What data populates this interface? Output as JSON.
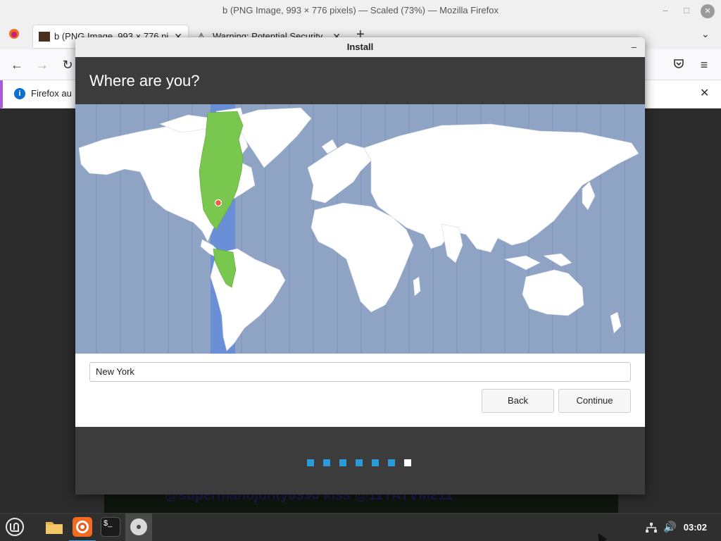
{
  "firefox": {
    "window_title": "b (PNG Image, 993 × 776 pixels) — Scaled (73%) — Mozilla Firefox",
    "tabs": [
      {
        "label": "b (PNG Image, 993 × 776 pi",
        "icon": "image-thumbnail-icon"
      },
      {
        "label": "Warning: Potential Security",
        "icon": "warning-icon"
      }
    ],
    "new_tab_label": "+",
    "notice_text": "Firefox au"
  },
  "background_image_text": "@supermanojonty6990 kiss @11YATVM211",
  "installer": {
    "window_title": "Install",
    "minimize_label": "–",
    "heading": "Where are you?",
    "timezone_input": {
      "value": "New York"
    },
    "back_label": "Back",
    "continue_label": "Continue",
    "progress": {
      "total_steps": 7,
      "current_step": 7
    },
    "colors": {
      "header": "#3c3c3c",
      "map_ocean": "#8fa3c4",
      "timezone_band": "#6b8fd6",
      "timezone_region": "#7ac74f",
      "step_dot": "#2a9ad8",
      "step_dot_current": "#ffffff"
    }
  },
  "taskbar": {
    "clock": "03:02",
    "apps": [
      "mint-menu-icon",
      "files-icon",
      "firefox-icon",
      "terminal-icon",
      "disc-icon"
    ]
  }
}
